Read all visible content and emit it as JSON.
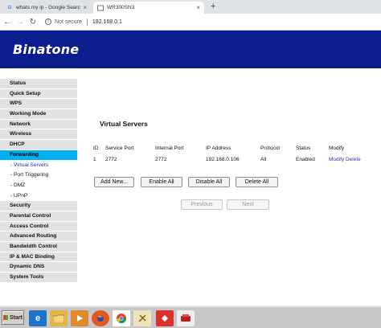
{
  "browser": {
    "tabs": [
      {
        "title": "whats my ip - Google Search",
        "favicon": "G"
      },
      {
        "title": "WR300SN3"
      }
    ],
    "new_tab": "+",
    "close": "×",
    "security": "Not secure",
    "url": "192.168.0.1"
  },
  "router": {
    "brand": "Binatone",
    "banner_color": "#0c1e8e",
    "nav": [
      {
        "label": "Status"
      },
      {
        "label": "Quick Setup"
      },
      {
        "label": "WPS"
      },
      {
        "label": "Working Mode"
      },
      {
        "label": "Network"
      },
      {
        "label": "Wireless"
      },
      {
        "label": "DHCP"
      },
      {
        "label": "Forwarding"
      },
      {
        "label": "- Virtual Servers"
      },
      {
        "label": "- Port Triggering"
      },
      {
        "label": "- DMZ"
      },
      {
        "label": "- UPnP"
      },
      {
        "label": "Security"
      },
      {
        "label": "Parental Control"
      },
      {
        "label": "Access Control"
      },
      {
        "label": "Advanced Routing"
      },
      {
        "label": "Bandwidth Control"
      },
      {
        "label": "IP & MAC Binding"
      },
      {
        "label": "Dynamic DNS"
      },
      {
        "label": "System Tools"
      }
    ],
    "active_section": "Forwarding",
    "active_subitem": "- Virtual Servers"
  },
  "virtual_servers": {
    "title": "Virtual Servers",
    "columns": [
      "ID",
      "Service Port",
      "Internal Port",
      "IP Address",
      "Protocol",
      "Status",
      "Modify"
    ],
    "rows": [
      {
        "id": "1",
        "service_port": "2772",
        "internal_port": "2772",
        "ip": "192.168.0.106",
        "protocol": "All",
        "status": "Enabled",
        "modify": "Modify",
        "delete": "Delete"
      }
    ],
    "buttons": {
      "add_new": "Add New...",
      "enable_all": "Enable All",
      "disable_all": "Disable All",
      "delete_all": "Delete All"
    },
    "pager": {
      "previous": "Previous",
      "next": "Next"
    }
  },
  "taskbar": {
    "start": "Start",
    "apps": [
      {
        "icon": "ie-icon",
        "color": "#1e73c9"
      },
      {
        "icon": "explorer-folder-icon",
        "color": "#e3b64a"
      },
      {
        "icon": "media-player-icon",
        "color": "#e08a2a"
      },
      {
        "icon": "firefox-icon",
        "color": "#e2571e"
      },
      {
        "icon": "chrome-icon",
        "color": "#2aa34a"
      },
      {
        "icon": "tool-icon",
        "color": "#b28b3a"
      },
      {
        "icon": "anydesk-icon",
        "color": "#d9312b"
      },
      {
        "icon": "network-icon",
        "color": "#b02222"
      }
    ]
  }
}
